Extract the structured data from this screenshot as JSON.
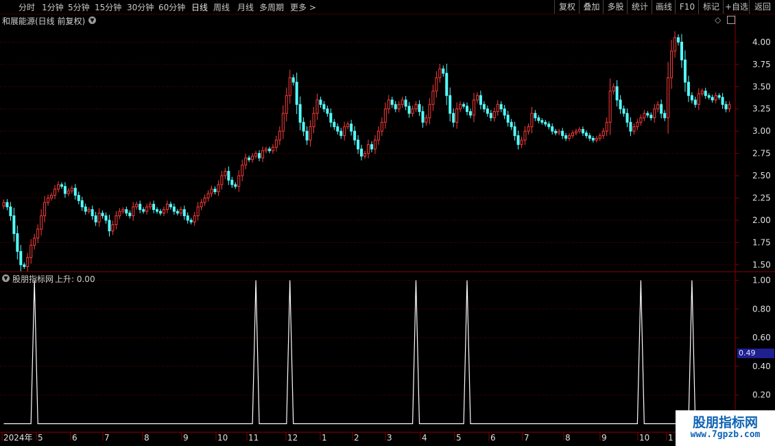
{
  "toolbar": {
    "periods": [
      "分时",
      "1分钟",
      "5分钟",
      "15分钟",
      "30分钟",
      "60分钟",
      "日线",
      "周线",
      "月线",
      "多周期",
      "更多 >"
    ],
    "active_period": "日线",
    "actions": [
      "复权",
      "叠加",
      "多股",
      "统计",
      "画线",
      "F10",
      "标记",
      "+自选",
      "返回"
    ]
  },
  "main_panel": {
    "title": "和展能源(日线 前复权)"
  },
  "indicator_panel": {
    "title": "股朋指标网",
    "value_label": "上升: 0.00",
    "cursor_value": "0.49"
  },
  "watermark": {
    "title": "股朋指标网",
    "url": "www.7gpzb.com"
  },
  "colors": {
    "up": "#ff3b3b",
    "down": "#54ffff",
    "grid": "#7a0000",
    "axis": "#8b0000",
    "indicator": "#ffffff",
    "cursor_box": "#1f1f8f"
  },
  "icons": {
    "dropdown": "chevron-down-icon",
    "diamond": "diamond-icon",
    "panel_toggle": "panel-toggle-icon"
  },
  "chart_data": [
    {
      "type": "candlestick",
      "y_ticks": [
        1.5,
        1.75,
        2.0,
        2.25,
        2.5,
        2.75,
        3.0,
        3.25,
        3.5,
        3.75,
        4.0
      ],
      "ylim": [
        1.43,
        4.18
      ],
      "x_labels": [
        "2024年",
        "5",
        "6",
        "7",
        "8",
        "9",
        "10",
        "11",
        "12",
        "1",
        "2",
        "3",
        "4",
        "5",
        "6",
        "7",
        "8",
        "9",
        "10",
        "1"
      ],
      "grid": true,
      "closes": [
        2.2,
        2.15,
        2.05,
        1.85,
        1.65,
        1.5,
        1.48,
        1.58,
        1.72,
        1.8,
        1.9,
        2.05,
        2.2,
        2.25,
        2.28,
        2.35,
        2.4,
        2.38,
        2.3,
        2.33,
        2.36,
        2.28,
        2.22,
        2.15,
        2.1,
        2.12,
        2.05,
        1.98,
        2.08,
        2.05,
        2.0,
        1.88,
        1.95,
        2.05,
        2.1,
        2.12,
        2.08,
        2.05,
        2.15,
        2.18,
        2.12,
        2.1,
        2.15,
        2.18,
        2.12,
        2.1,
        2.08,
        2.12,
        2.18,
        2.15,
        2.1,
        2.08,
        2.12,
        2.05,
        2.0,
        1.98,
        2.05,
        2.15,
        2.2,
        2.25,
        2.3,
        2.35,
        2.32,
        2.4,
        2.5,
        2.55,
        2.45,
        2.4,
        2.38,
        2.5,
        2.62,
        2.7,
        2.68,
        2.72,
        2.75,
        2.7,
        2.78,
        2.8,
        2.78,
        2.82,
        2.9,
        3.0,
        3.2,
        3.4,
        3.6,
        3.55,
        3.3,
        3.1,
        3.0,
        2.9,
        3.05,
        3.2,
        3.35,
        3.3,
        3.25,
        3.2,
        3.1,
        3.05,
        3.0,
        2.95,
        3.05,
        3.08,
        3.0,
        2.9,
        2.8,
        2.72,
        2.75,
        2.85,
        2.8,
        2.9,
        3.0,
        3.1,
        3.25,
        3.35,
        3.3,
        3.25,
        3.3,
        3.35,
        3.28,
        3.2,
        3.25,
        3.3,
        3.22,
        3.1,
        3.15,
        3.3,
        3.45,
        3.6,
        3.7,
        3.65,
        3.4,
        3.2,
        3.1,
        3.25,
        3.3,
        3.28,
        3.22,
        3.18,
        3.35,
        3.4,
        3.3,
        3.25,
        3.2,
        3.15,
        3.22,
        3.3,
        3.25,
        3.18,
        3.1,
        3.05,
        2.95,
        2.85,
        2.9,
        3.0,
        3.05,
        3.2,
        3.15,
        3.12,
        3.1,
        3.08,
        3.05,
        3.0,
        2.98,
        3.0,
        2.95,
        2.92,
        2.95,
        2.98,
        3.0,
        3.02,
        2.98,
        2.95,
        2.92,
        2.9,
        2.92,
        2.95,
        3.0,
        3.1,
        3.45,
        3.5,
        3.35,
        3.25,
        3.2,
        3.1,
        3.0,
        3.05,
        3.1,
        3.15,
        3.2,
        3.18,
        3.15,
        3.25,
        3.3,
        3.2,
        3.15,
        3.6,
        3.9,
        4.05,
        4.0,
        3.8,
        3.55,
        3.4,
        3.35,
        3.3,
        3.42,
        3.45,
        3.4,
        3.38,
        3.35,
        3.4,
        3.38,
        3.3,
        3.25,
        3.3
      ]
    },
    {
      "type": "line",
      "y_ticks": [
        0.2,
        0.4,
        0.6,
        0.8,
        1.0
      ],
      "ylim": [
        -0.05,
        1.05
      ],
      "grid": true,
      "series": [
        {
          "values": [
            0,
            0,
            0,
            0,
            0,
            0,
            0,
            0,
            0,
            1,
            0,
            0,
            0,
            0,
            0,
            0,
            0,
            0,
            0,
            0,
            0,
            0,
            0,
            0,
            0,
            0,
            0,
            0,
            0,
            0,
            0,
            0,
            0,
            0,
            0,
            0,
            0,
            0,
            0,
            0,
            0,
            0,
            0,
            0,
            0,
            0,
            0,
            0,
            0,
            0,
            0,
            0,
            0,
            0,
            0,
            0,
            0,
            0,
            0,
            0,
            0,
            0,
            0,
            0,
            0,
            0,
            0,
            0,
            0,
            0,
            0,
            0,
            0,
            0,
            1,
            0,
            0,
            0,
            0,
            0,
            0,
            0,
            0,
            0,
            1,
            0,
            0,
            0,
            0,
            0,
            0,
            0,
            0,
            0,
            0,
            0,
            0,
            0,
            0,
            0,
            0,
            0,
            0,
            0,
            0,
            0,
            0,
            0,
            0,
            0,
            0,
            0,
            0,
            0,
            0,
            0,
            0,
            0,
            0,
            0,
            0,
            1,
            0,
            0,
            0,
            0,
            0,
            0,
            0,
            0,
            0,
            0,
            0,
            0,
            0,
            0,
            1,
            0,
            0,
            0,
            0,
            0,
            0,
            0,
            0,
            0,
            0,
            0,
            0,
            0,
            0,
            0,
            0,
            0,
            0,
            0,
            0,
            0,
            0,
            0,
            0,
            0,
            0,
            0,
            0,
            0,
            0,
            0,
            0,
            0,
            0,
            0,
            0,
            0,
            0,
            0,
            0,
            0,
            0,
            0,
            0,
            0,
            0,
            0,
            0,
            0,
            0,
            1,
            0,
            0,
            0,
            0,
            0,
            0,
            0,
            0,
            0,
            0,
            0,
            0,
            0,
            0,
            1,
            0,
            0,
            0,
            0,
            0,
            0,
            0,
            0,
            0,
            0,
            0,
            0,
            0,
            0,
            0,
            0,
            0,
            0,
            0,
            0
          ]
        }
      ]
    }
  ]
}
